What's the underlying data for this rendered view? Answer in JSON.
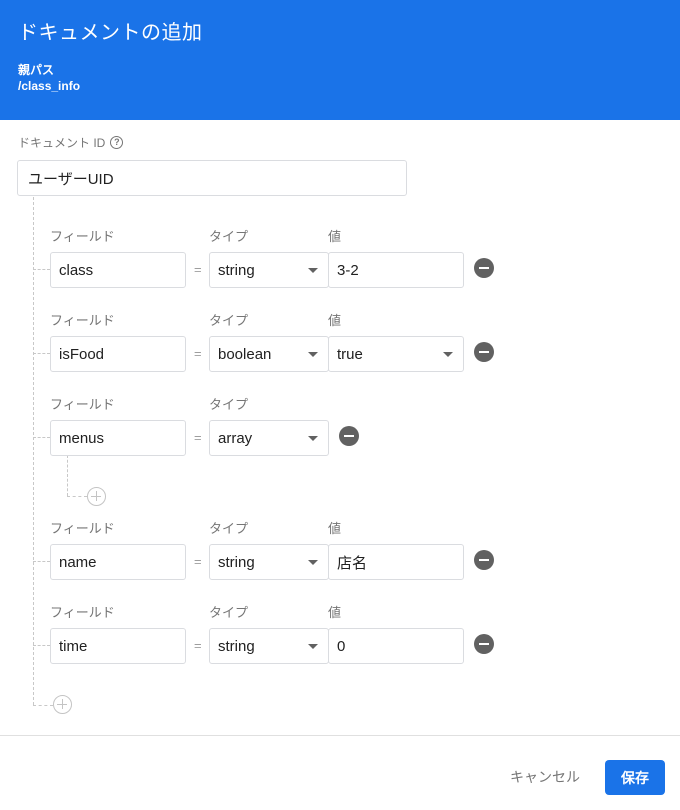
{
  "dialog": {
    "title": "ドキュメントの追加",
    "parent_path_label": "親パス",
    "parent_path": "/class_info"
  },
  "document_id": {
    "label": "ドキュメント ID",
    "help_icon": "?",
    "value": "ユーザーUID"
  },
  "column_labels": {
    "field": "フィールド",
    "type": "タイプ",
    "value": "値"
  },
  "equals_sign": "=",
  "fields": [
    {
      "name": "class",
      "type": "string",
      "value": "3-2"
    },
    {
      "name": "isFood",
      "type": "boolean",
      "value": "true"
    },
    {
      "name": "menus",
      "type": "array"
    },
    {
      "name": "name",
      "type": "string",
      "value": "店名"
    },
    {
      "name": "time",
      "type": "string",
      "value": "0"
    }
  ],
  "footer": {
    "cancel": "キャンセル",
    "save": "保存"
  },
  "colors": {
    "primary": "#1a73e8",
    "remove_button": "#616161"
  },
  "icons": {
    "help": "help-circle-icon",
    "remove": "remove-circle-icon",
    "add": "add-circle-icon",
    "dropdown": "dropdown-arrow-icon"
  }
}
